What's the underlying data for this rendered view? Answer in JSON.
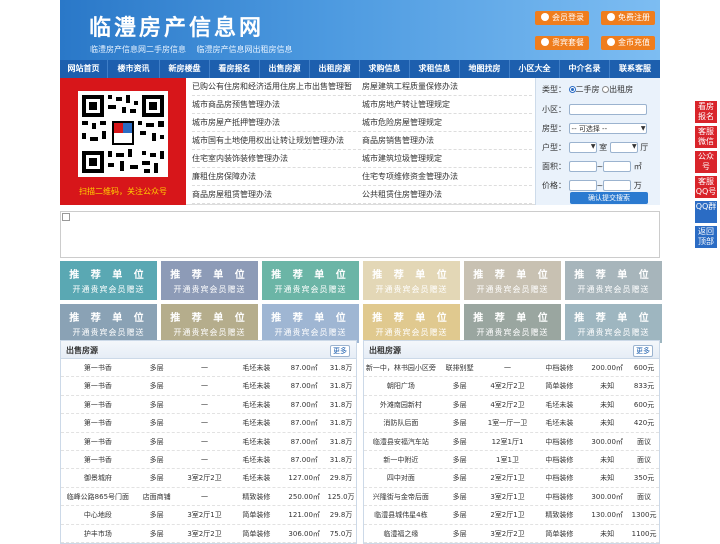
{
  "header": {
    "logo": "临澧房产信息网",
    "subtitle_1": "临澧房产信息网二手房信息",
    "subtitle_2": "临澧房产信息网出租房信息",
    "buttons": [
      {
        "label": "会员登录"
      },
      {
        "label": "免费注册"
      },
      {
        "label": "贵宾套餐"
      },
      {
        "label": "金币充值"
      }
    ]
  },
  "nav": [
    "网站首页",
    "楼市资讯",
    "新房楼盘",
    "看房报名",
    "出售房源",
    "出租房源",
    "求购信息",
    "求租信息",
    "地图找房",
    "小区大全",
    "中介名录",
    "联系客服"
  ],
  "qr": {
    "caption": "扫描二维码，关注公众号"
  },
  "links": [
    [
      "已购公有住房和经济适用住房上市出售管理暂",
      "房屋建筑工程质量保修办法"
    ],
    [
      "城市商品房预售管理办法",
      "城市房地产转让管理规定"
    ],
    [
      "城市房屋产抵押管理办法",
      "城市危险房屋管理规定"
    ],
    [
      "城市国有土地使用权出让转让规划管理办法",
      "商品房销售管理办法"
    ],
    [
      "住宅室内装饰装修管理办法",
      "城市建筑垃圾管理规定"
    ],
    [
      "廉租住房保障办法",
      "住宅专项维修资金管理办法"
    ],
    [
      "商品房屋租赁管理办法",
      "公共租赁住房管理办法"
    ]
  ],
  "search": {
    "type_label": "类型：",
    "opt_sale": "二手房",
    "opt_rent": "出租房",
    "community_label": "小区：",
    "housetype_label": "房型：",
    "housetype_value": "-- 可选择 --",
    "layout_label": "户型：",
    "room_unit": "室",
    "hall_unit": "厅",
    "area_label": "面积：",
    "area_unit": "㎡",
    "price_label": "价格：",
    "price_unit": "万",
    "submit": "确认提交搜索"
  },
  "ads": {
    "title": "推 荐 单 位",
    "sub": "开通贵宾会员赠送"
  },
  "sale": {
    "title": "出售房源",
    "more": "更多",
    "rows": [
      [
        "第一书香",
        "多层",
        "一",
        "毛坯未装",
        "87.00㎡",
        "31.8万"
      ],
      [
        "第一书香",
        "多层",
        "一",
        "毛坯未装",
        "87.00㎡",
        "31.8万"
      ],
      [
        "第一书香",
        "多层",
        "一",
        "毛坯未装",
        "87.00㎡",
        "31.8万"
      ],
      [
        "第一书香",
        "多层",
        "一",
        "毛坯未装",
        "87.00㎡",
        "31.8万"
      ],
      [
        "第一书香",
        "多层",
        "一",
        "毛坯未装",
        "87.00㎡",
        "31.8万"
      ],
      [
        "第一书香",
        "多层",
        "一",
        "毛坯未装",
        "87.00㎡",
        "31.8万"
      ],
      [
        "御景城府",
        "多层",
        "3室2厅2卫",
        "毛坯未装",
        "127.00㎡",
        "29.8万"
      ],
      [
        "临峰公路865号门面",
        "店面商铺",
        "一",
        "精致装修",
        "250.00㎡",
        "125.0万"
      ],
      [
        "中心地段",
        "多层",
        "3室2厅1卫",
        "简单装修",
        "121.00㎡",
        "29.8万"
      ],
      [
        "护丰市场",
        "多层",
        "3室2厅2卫",
        "简单装修",
        "306.00㎡",
        "75.0万"
      ]
    ]
  },
  "rent": {
    "title": "出租房源",
    "more": "更多",
    "rows": [
      [
        "新一中，林书园小区旁",
        "联排别墅",
        "一",
        "中档装修",
        "200.00㎡",
        "600元"
      ],
      [
        "朝阳广场",
        "多层",
        "4室2厅2卫",
        "简单装修",
        "未知",
        "833元"
      ],
      [
        "外滩南园新村",
        "多层",
        "4室2厅2卫",
        "毛坯未装",
        "未知",
        "600元"
      ],
      [
        "消防队后面",
        "多层",
        "1室一厅一卫",
        "毛坯未装",
        "未知",
        "420元"
      ],
      [
        "临澧县安福汽车站",
        "多层",
        "12室1厅1",
        "中档装修",
        "300.00㎡",
        "面议"
      ],
      [
        "新一中附近",
        "多层",
        "1室1卫",
        "中档装修",
        "未知",
        "面议"
      ],
      [
        "四中对面",
        "多层",
        "2室2厅1卫",
        "中档装修",
        "未知",
        "350元"
      ],
      [
        "兴隆街与金帝后面",
        "多层",
        "3室2厅1卫",
        "中档装修",
        "300.00㎡",
        "面议"
      ],
      [
        "临澧县城伟星4栋",
        "多层",
        "2室2厅1卫",
        "精致装修",
        "130.00㎡",
        "1300元"
      ],
      [
        "临澧福之缘",
        "多层",
        "3室2厅2卫",
        "简单装修",
        "未知",
        "1100元"
      ]
    ]
  },
  "side": [
    "看房报名",
    "客服微信",
    "公众号",
    "客服QQ号",
    "QQ群",
    "返回顶部"
  ]
}
